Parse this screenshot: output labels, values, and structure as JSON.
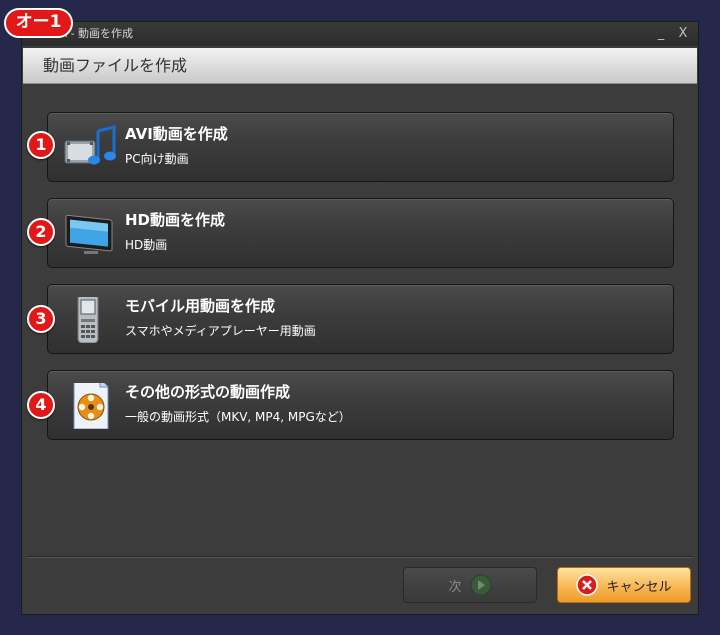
{
  "app": {
    "window_title": "BA - 動画を作成",
    "minimize_glyph": "_",
    "close_glyph": "X",
    "header": "動画ファイルを作成"
  },
  "annotation": {
    "tag": "オー1"
  },
  "options": [
    {
      "badge": "1",
      "title": "AVI動画を作成",
      "subtitle": "PC向け動画",
      "icon": "film-music-icon"
    },
    {
      "badge": "2",
      "title": "HD動画を作成",
      "subtitle": "HD動画",
      "icon": "monitor-icon"
    },
    {
      "badge": "3",
      "title": "モバイル用動画を作成",
      "subtitle": "スマホやメディアプレーヤー用動画",
      "icon": "mobile-phone-icon"
    },
    {
      "badge": "4",
      "title": "その他の形式の動画作成",
      "subtitle": "一般の動画形式（MKV, MP4, MPGなど）",
      "icon": "video-file-icon"
    }
  ],
  "footer": {
    "next_label": "次",
    "cancel_label": "キャンセル"
  },
  "colors": {
    "accent": "#e21717",
    "cancel": "#f6b34e",
    "background": "#25284a"
  }
}
